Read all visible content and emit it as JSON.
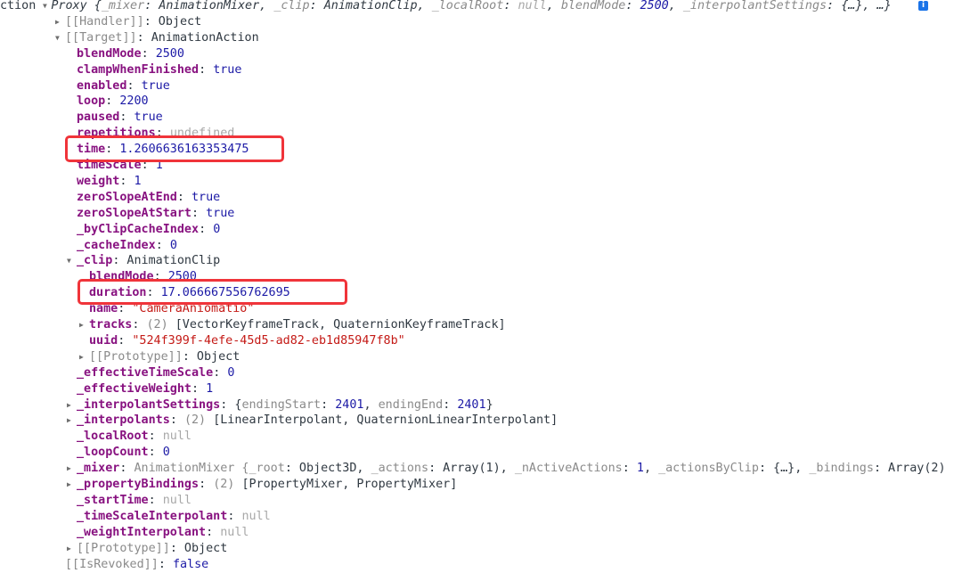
{
  "colors": {
    "key": "#881280",
    "number": "#1c1aa6",
    "string": "#c41a16",
    "null": "#a8a8a8",
    "highlight": "#f0343a",
    "info": "#1a73e8"
  },
  "info_icon": {
    "icon": "info-icon",
    "label": "i"
  },
  "rows": [
    {
      "lvl": 0,
      "arrow": "down",
      "segs": [
        {
          "t": "ction ",
          "c": "o"
        },
        {
          "t": "",
          "c": "arrowslot"
        },
        {
          "t": "Proxy {",
          "c": "o it"
        },
        {
          "t": "_mixer",
          "c": "p it"
        },
        {
          "t": ": AnimationMixer, ",
          "c": "o it"
        },
        {
          "t": "_clip",
          "c": "p it"
        },
        {
          "t": ": AnimationClip, ",
          "c": "o it"
        },
        {
          "t": "_localRoot",
          "c": "p it"
        },
        {
          "t": ": ",
          "c": "o it"
        },
        {
          "t": "null",
          "c": "nl it"
        },
        {
          "t": ", ",
          "c": "o it"
        },
        {
          "t": "blendMode",
          "c": "p it"
        },
        {
          "t": ": ",
          "c": "o it"
        },
        {
          "t": "2500",
          "c": "n it"
        },
        {
          "t": ", ",
          "c": "o it"
        },
        {
          "t": "_interpolantSettings",
          "c": "p it"
        },
        {
          "t": ": {…}, …}",
          "c": "o it"
        }
      ]
    },
    {
      "lvl": 1,
      "arrow": "right",
      "segs": [
        {
          "t": "[[Handler]]",
          "c": "ik"
        },
        {
          "t": ": Object",
          "c": "o"
        }
      ]
    },
    {
      "lvl": 1,
      "arrow": "down",
      "segs": [
        {
          "t": "[[Target]]",
          "c": "ik"
        },
        {
          "t": ": AnimationAction",
          "c": "o"
        }
      ]
    },
    {
      "lvl": 2,
      "segs": [
        {
          "t": "blendMode",
          "c": "k"
        },
        {
          "t": ": ",
          "c": "o"
        },
        {
          "t": "2500",
          "c": "n"
        }
      ]
    },
    {
      "lvl": 2,
      "segs": [
        {
          "t": "clampWhenFinished",
          "c": "k"
        },
        {
          "t": ": ",
          "c": "o"
        },
        {
          "t": "true",
          "c": "n"
        }
      ]
    },
    {
      "lvl": 2,
      "segs": [
        {
          "t": "enabled",
          "c": "k"
        },
        {
          "t": ": ",
          "c": "o"
        },
        {
          "t": "true",
          "c": "n"
        }
      ]
    },
    {
      "lvl": 2,
      "segs": [
        {
          "t": "loop",
          "c": "k"
        },
        {
          "t": ": ",
          "c": "o"
        },
        {
          "t": "2200",
          "c": "n"
        }
      ]
    },
    {
      "lvl": 2,
      "segs": [
        {
          "t": "paused",
          "c": "k"
        },
        {
          "t": ": ",
          "c": "o"
        },
        {
          "t": "true",
          "c": "n"
        }
      ]
    },
    {
      "lvl": 2,
      "segs": [
        {
          "t": "repetitions",
          "c": "k"
        },
        {
          "t": ": ",
          "c": "o"
        },
        {
          "t": "undefined",
          "c": "nl"
        }
      ]
    },
    {
      "lvl": 2,
      "segs": [
        {
          "t": "time",
          "c": "k"
        },
        {
          "t": ": ",
          "c": "o"
        },
        {
          "t": "1.2606636163353475",
          "c": "n"
        }
      ]
    },
    {
      "lvl": 2,
      "segs": [
        {
          "t": "timeScale",
          "c": "k"
        },
        {
          "t": ": ",
          "c": "o"
        },
        {
          "t": "1",
          "c": "n"
        }
      ]
    },
    {
      "lvl": 2,
      "segs": [
        {
          "t": "weight",
          "c": "k"
        },
        {
          "t": ": ",
          "c": "o"
        },
        {
          "t": "1",
          "c": "n"
        }
      ]
    },
    {
      "lvl": 2,
      "segs": [
        {
          "t": "zeroSlopeAtEnd",
          "c": "k"
        },
        {
          "t": ": ",
          "c": "o"
        },
        {
          "t": "true",
          "c": "n"
        }
      ]
    },
    {
      "lvl": 2,
      "segs": [
        {
          "t": "zeroSlopeAtStart",
          "c": "k"
        },
        {
          "t": ": ",
          "c": "o"
        },
        {
          "t": "true",
          "c": "n"
        }
      ]
    },
    {
      "lvl": 2,
      "segs": [
        {
          "t": "_byClipCacheIndex",
          "c": "k"
        },
        {
          "t": ": ",
          "c": "o"
        },
        {
          "t": "0",
          "c": "n"
        }
      ]
    },
    {
      "lvl": 2,
      "segs": [
        {
          "t": "_cacheIndex",
          "c": "k"
        },
        {
          "t": ": ",
          "c": "o"
        },
        {
          "t": "0",
          "c": "n"
        }
      ]
    },
    {
      "lvl": 2,
      "arrow": "down",
      "segs": [
        {
          "t": "_clip",
          "c": "k"
        },
        {
          "t": ": AnimationClip",
          "c": "o"
        }
      ]
    },
    {
      "lvl": 3,
      "segs": [
        {
          "t": "blendMode",
          "c": "k"
        },
        {
          "t": ": ",
          "c": "o"
        },
        {
          "t": "2500",
          "c": "n"
        }
      ]
    },
    {
      "lvl": 3,
      "segs": [
        {
          "t": "duration",
          "c": "k"
        },
        {
          "t": ": ",
          "c": "o"
        },
        {
          "t": "17.066667556762695",
          "c": "n"
        }
      ]
    },
    {
      "lvl": 3,
      "segs": [
        {
          "t": "name",
          "c": "k"
        },
        {
          "t": ": ",
          "c": "o"
        },
        {
          "t": "\"CameraAniomatio\"",
          "c": "s"
        }
      ]
    },
    {
      "lvl": 3,
      "arrow": "right",
      "segs": [
        {
          "t": "tracks",
          "c": "k"
        },
        {
          "t": ": ",
          "c": "o"
        },
        {
          "t": "(2) ",
          "c": "p"
        },
        {
          "t": "[VectorKeyframeTrack, QuaternionKeyframeTrack]",
          "c": "o"
        }
      ]
    },
    {
      "lvl": 3,
      "segs": [
        {
          "t": "uuid",
          "c": "k"
        },
        {
          "t": ": ",
          "c": "o"
        },
        {
          "t": "\"524f399f-4efe-45d5-ad82-eb1d85947f8b\"",
          "c": "s"
        }
      ]
    },
    {
      "lvl": 3,
      "arrow": "right",
      "segs": [
        {
          "t": "[[Prototype]]",
          "c": "ik"
        },
        {
          "t": ": Object",
          "c": "o"
        }
      ]
    },
    {
      "lvl": 2,
      "segs": [
        {
          "t": "_effectiveTimeScale",
          "c": "k"
        },
        {
          "t": ": ",
          "c": "o"
        },
        {
          "t": "0",
          "c": "n"
        }
      ]
    },
    {
      "lvl": 2,
      "segs": [
        {
          "t": "_effectiveWeight",
          "c": "k"
        },
        {
          "t": ": ",
          "c": "o"
        },
        {
          "t": "1",
          "c": "n"
        }
      ]
    },
    {
      "lvl": 2,
      "arrow": "right",
      "segs": [
        {
          "t": "_interpolantSettings",
          "c": "k"
        },
        {
          "t": ": {",
          "c": "o"
        },
        {
          "t": "endingStart",
          "c": "p"
        },
        {
          "t": ": ",
          "c": "o"
        },
        {
          "t": "2401",
          "c": "n"
        },
        {
          "t": ", ",
          "c": "o"
        },
        {
          "t": "endingEnd",
          "c": "p"
        },
        {
          "t": ": ",
          "c": "o"
        },
        {
          "t": "2401",
          "c": "n"
        },
        {
          "t": "}",
          "c": "o"
        }
      ]
    },
    {
      "lvl": 2,
      "arrow": "right",
      "segs": [
        {
          "t": "_interpolants",
          "c": "k"
        },
        {
          "t": ": ",
          "c": "o"
        },
        {
          "t": "(2) ",
          "c": "p"
        },
        {
          "t": "[LinearInterpolant, QuaternionLinearInterpolant]",
          "c": "o"
        }
      ]
    },
    {
      "lvl": 2,
      "segs": [
        {
          "t": "_localRoot",
          "c": "k"
        },
        {
          "t": ": ",
          "c": "o"
        },
        {
          "t": "null",
          "c": "nl"
        }
      ]
    },
    {
      "lvl": 2,
      "segs": [
        {
          "t": "_loopCount",
          "c": "k"
        },
        {
          "t": ": ",
          "c": "o"
        },
        {
          "t": "0",
          "c": "n"
        }
      ]
    },
    {
      "lvl": 2,
      "arrow": "right",
      "segs": [
        {
          "t": "_mixer",
          "c": "k"
        },
        {
          "t": ": ",
          "c": "o"
        },
        {
          "t": "AnimationMixer {",
          "c": "p"
        },
        {
          "t": "_root",
          "c": "p"
        },
        {
          "t": ": Object3D, ",
          "c": "o"
        },
        {
          "t": "_actions",
          "c": "p"
        },
        {
          "t": ": Array(1), ",
          "c": "o"
        },
        {
          "t": "_nActiveActions",
          "c": "p"
        },
        {
          "t": ": ",
          "c": "o"
        },
        {
          "t": "1",
          "c": "n"
        },
        {
          "t": ", ",
          "c": "o"
        },
        {
          "t": "_actionsByClip",
          "c": "p"
        },
        {
          "t": ": {…}, ",
          "c": "o"
        },
        {
          "t": "_bindings",
          "c": "p"
        },
        {
          "t": ": Array(2)",
          "c": "o"
        }
      ]
    },
    {
      "lvl": 2,
      "arrow": "right",
      "segs": [
        {
          "t": "_propertyBindings",
          "c": "k"
        },
        {
          "t": ": ",
          "c": "o"
        },
        {
          "t": "(2) ",
          "c": "p"
        },
        {
          "t": "[PropertyMixer, PropertyMixer]",
          "c": "o"
        }
      ]
    },
    {
      "lvl": 2,
      "segs": [
        {
          "t": "_startTime",
          "c": "k"
        },
        {
          "t": ": ",
          "c": "o"
        },
        {
          "t": "null",
          "c": "nl"
        }
      ]
    },
    {
      "lvl": 2,
      "segs": [
        {
          "t": "_timeScaleInterpolant",
          "c": "k"
        },
        {
          "t": ": ",
          "c": "o"
        },
        {
          "t": "null",
          "c": "nl"
        }
      ]
    },
    {
      "lvl": 2,
      "segs": [
        {
          "t": "_weightInterpolant",
          "c": "k"
        },
        {
          "t": ": ",
          "c": "o"
        },
        {
          "t": "null",
          "c": "nl"
        }
      ]
    },
    {
      "lvl": 2,
      "arrow": "right",
      "segs": [
        {
          "t": "[[Prototype]]",
          "c": "ik"
        },
        {
          "t": ": Object",
          "c": "o"
        }
      ]
    },
    {
      "lvl": 1,
      "segs": [
        {
          "t": "[[IsRevoked]]",
          "c": "ik"
        },
        {
          "t": ": ",
          "c": "o"
        },
        {
          "t": "false",
          "c": "n"
        }
      ]
    }
  ]
}
